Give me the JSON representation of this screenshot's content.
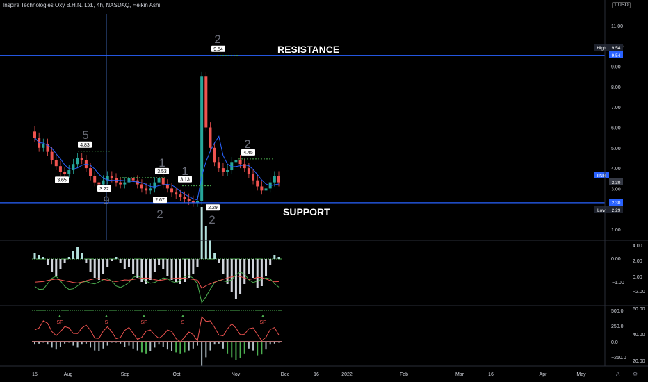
{
  "header": {
    "title": "Inspira Technologies Oxy B.H.N. Ltd., 4h, NASDAQ, Heikin Ashi",
    "currency": "USD",
    "currency_prefix": "1"
  },
  "bottom_bar": {
    "auto_label": "A",
    "log_label": "⚙"
  },
  "chart_data": {
    "type": "candlestick",
    "x_labels": [
      "15",
      "Aug",
      "Sep",
      "Oct",
      "Nov",
      "Dec",
      "16",
      "2022",
      "Feb",
      "Mar",
      "16",
      "Apr",
      "May"
    ],
    "price_ticks": [
      "11.00",
      "10.00",
      "9.00",
      "8.00",
      "7.00",
      "6.00",
      "5.00",
      "4.00",
      "3.00",
      "2.00",
      "1.00"
    ],
    "price_range": [
      0.5,
      11.8
    ],
    "annotations": {
      "resistance": {
        "label": "RESISTANCE",
        "price": 9.54
      },
      "support": {
        "label": "SUPPORT",
        "price": 2.3
      }
    },
    "price_tags": [
      {
        "label": "High",
        "value": "9.54"
      },
      {
        "label": "",
        "value": "9.54"
      },
      {
        "label": "IINN",
        "value": ""
      },
      {
        "label": "",
        "value": "3.30"
      },
      {
        "label": "",
        "value": "2.30"
      },
      {
        "label": "Low",
        "value": "2.29"
      }
    ],
    "point_labels": [
      {
        "text": "4.83",
        "price": 4.83
      },
      {
        "text": "3.65",
        "price": 3.65
      },
      {
        "text": "3.22",
        "price": 3.22
      },
      {
        "text": "3.53",
        "price": 3.53
      },
      {
        "text": "3.13",
        "price": 3.13
      },
      {
        "text": "2.67",
        "price": 2.67
      },
      {
        "text": "2.29",
        "price": 2.29
      },
      {
        "text": "9.54",
        "price": 9.54
      },
      {
        "text": "4.45",
        "price": 4.45
      }
    ],
    "count_labels": [
      "5",
      "9",
      "1",
      "1",
      "2",
      "2",
      "2",
      "2"
    ],
    "series": [
      {
        "name": "",
        "close": [
          5.5,
          5.0,
          5.2,
          4.8,
          4.4,
          4.1,
          3.8,
          3.7,
          3.9,
          4.2,
          4.5,
          4.4,
          4.0,
          3.6,
          3.3,
          3.2,
          3.4,
          3.6,
          3.5,
          3.3,
          3.2,
          3.3,
          3.5,
          3.4,
          3.2,
          3.0,
          2.9,
          3.0,
          3.3,
          3.5,
          3.2,
          3.0,
          2.8,
          2.7,
          2.6,
          2.5,
          2.4,
          2.3,
          2.4,
          8.5,
          6.0,
          5.0,
          4.3,
          4.0,
          3.8,
          3.9,
          4.3,
          4.4,
          4.2,
          4.0,
          3.7,
          3.4,
          3.1,
          2.9,
          3.0,
          3.3,
          3.6,
          3.3
        ]
      }
    ],
    "indicator_1": {
      "ticks": [
        "4.00",
        "2.00",
        "0.00",
        "−1.00",
        "−2.00"
      ],
      "zero_tick": "0.00",
      "histogram": [
        0.3,
        0.2,
        0.1,
        -0.3,
        -0.6,
        -0.8,
        -0.5,
        -0.2,
        0.1,
        0.4,
        0.6,
        0.3,
        -0.2,
        -0.6,
        -0.9,
        -1.0,
        -0.7,
        -0.4,
        -0.1,
        0.1,
        -0.2,
        -0.5,
        -0.4,
        -0.7,
        -0.9,
        -1.1,
        -1.2,
        -1.0,
        -0.6,
        -0.3,
        -0.5,
        -0.8,
        -1.0,
        -1.1,
        -1.2,
        -1.1,
        -0.9,
        -0.7,
        -0.4,
        2.5,
        1.6,
        0.9,
        0.3,
        -0.2,
        -0.7,
        -1.2,
        -1.6,
        -1.9,
        -1.7,
        -1.2,
        -0.7,
        -0.9,
        -1.4,
        -1.3,
        -0.8,
        -0.3,
        0.2,
        0.1
      ]
    },
    "indicator_2": {
      "ticks": [
        "500.0",
        "250.0",
        "0.0",
        "−250.0"
      ],
      "right_ticks": [
        "60.00",
        "40.00",
        "20.00"
      ],
      "signal_labels": [
        "SF",
        "S",
        "SF",
        "S",
        "SF"
      ]
    }
  }
}
